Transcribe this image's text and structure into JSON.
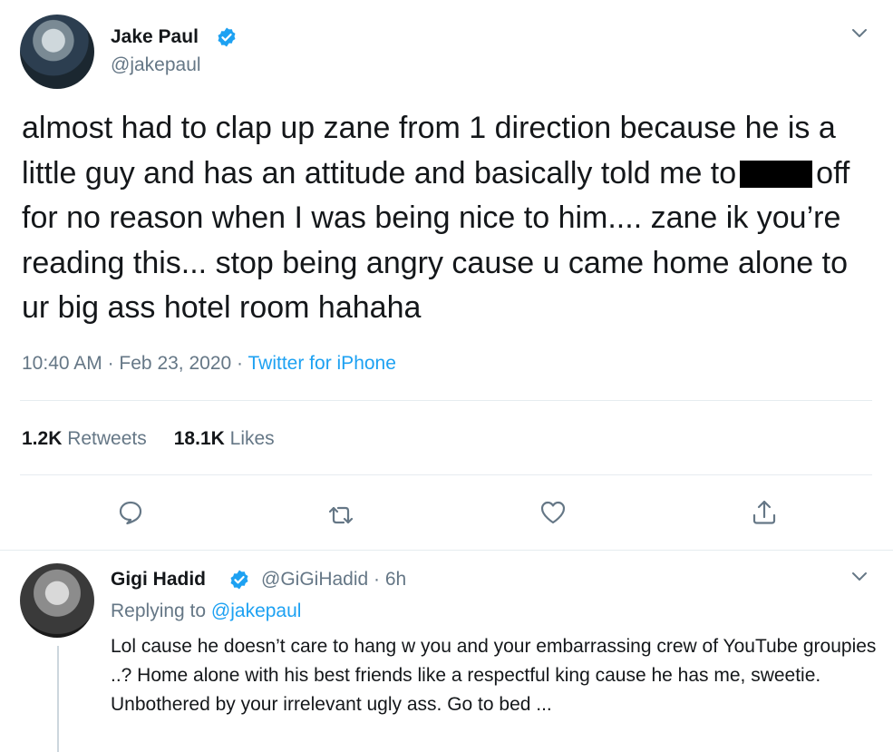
{
  "main_tweet": {
    "author_name": "Jake Paul",
    "handle": "@jakepaul",
    "text_part1": "almost had to clap up zane from 1 direction because he is a little guy and has an attitude and basically told me to",
    "text_part2": "off for no reason when I was being nice to him.... zane ik you’re reading this... stop being angry cause u came home alone to ur big ass hotel room hahaha",
    "time": "10:40 AM",
    "date": "Feb 23, 2020",
    "separator": "·",
    "client": "Twitter for iPhone",
    "retweets_count": "1.2K",
    "retweets_label": "Retweets",
    "likes_count": "18.1K",
    "likes_label": "Likes"
  },
  "reply_tweet": {
    "author_name": "Gigi Hadid",
    "handle": "@GiGiHadid",
    "age": "6h",
    "replying_prefix": "Replying to",
    "replying_to": "@jakepaul",
    "text": "Lol cause he doesn’t care to hang w you and your embarrassing crew of YouTube groupies ..? Home alone with his best friends like a respectful king cause he has me, sweetie. Unbothered by your irrelevant ugly ass. Go to bed ..."
  },
  "colors": {
    "accent": "#1da1f2",
    "muted": "#657786",
    "divider": "#e6ecf0",
    "text": "#14171a"
  },
  "icons": [
    "verified-icon",
    "chevron-down-icon",
    "reply-icon",
    "retweet-icon",
    "like-icon",
    "share-icon"
  ]
}
